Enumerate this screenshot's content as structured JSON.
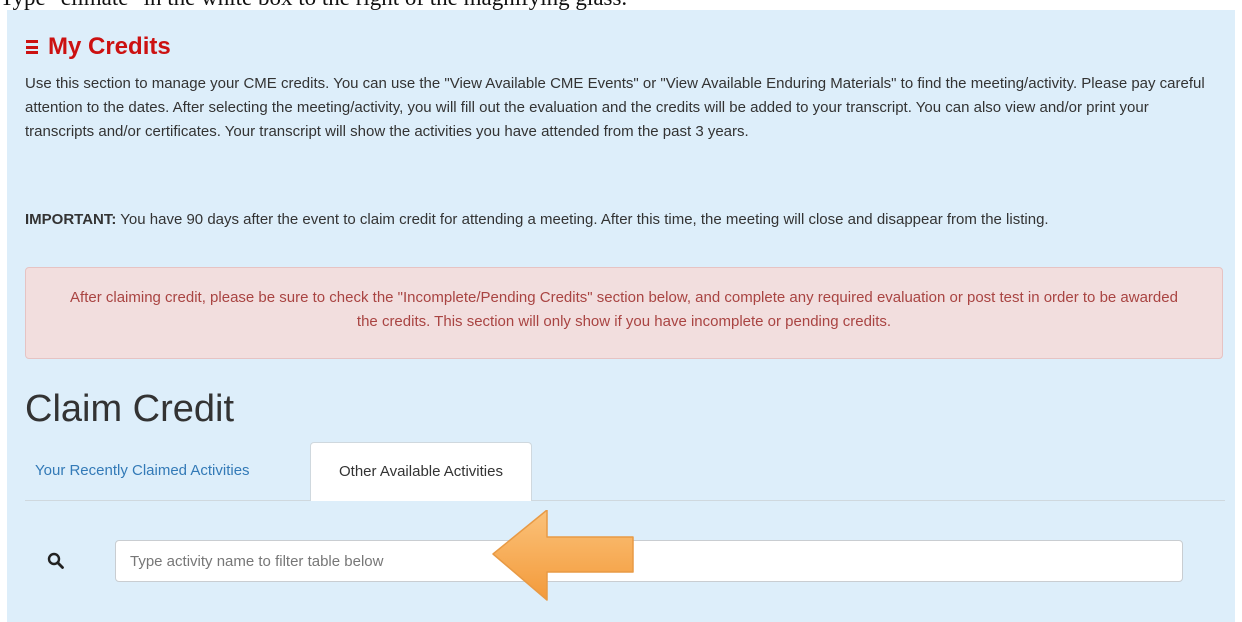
{
  "instruction": "Type \"climate\" in the white box to the right of the magnifying glass.",
  "header": {
    "title": "My Credits",
    "menu_icon": "hamburger-icon",
    "accent_color": "#cc1111"
  },
  "intro_text": "Use this section to manage your CME credits. You can use the \"View Available CME Events\" or \"View Available Enduring Materials\" to find the meeting/activity. Please pay careful attention to the dates. After selecting the meeting/activity, you will fill out the evaluation and the credits will be added to your transcript. You can also view and/or print your transcripts and/or certificates. Your transcript will show the activities you have attended from the past 3 years.",
  "important": {
    "label": "IMPORTANT:",
    "text": " You have 90 days after the event to claim credit for attending a meeting. After this time, the meeting will close and disappear from the listing."
  },
  "alert_text": "After claiming credit, please be sure to check the \"Incomplete/Pending Credits\" section below, and complete any required evaluation or post test in order to be awarded the credits. This section will only show if you have incomplete or pending credits.",
  "claim_title": "Claim Credit",
  "tabs": [
    {
      "label": "Your Recently Claimed Activities",
      "active": false
    },
    {
      "label": "Other Available Activities",
      "active": true
    }
  ],
  "search": {
    "icon": "search-icon",
    "placeholder": "Type activity name to filter table below",
    "value": ""
  },
  "annotation": {
    "icon": "pointer-arrow-icon",
    "color": "#f7a94b"
  }
}
